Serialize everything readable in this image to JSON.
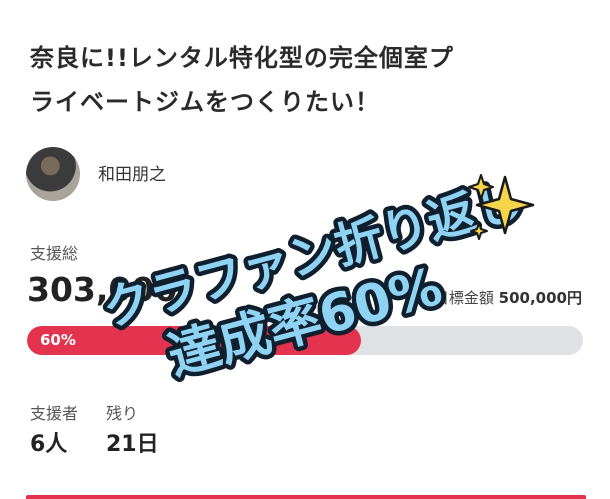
{
  "project": {
    "title_line1": "奈良に!!レンタル特化型の完全個室プ",
    "title_line2": "ライベートジムをつくりたい！",
    "owner_name": "和田朋之"
  },
  "funding": {
    "support_label": "支援総",
    "current_amount": "303,000",
    "goal_label": "目標金額",
    "goal_amount": "500,000円",
    "progress_percent": 60,
    "progress_label": "60%",
    "progress_color": "#e4334f"
  },
  "stats": {
    "supporters_label": "支援者",
    "supporters_value": "6人",
    "remaining_label": "残り",
    "remaining_value": "21日"
  },
  "overlay": {
    "line1": "クラファン折り返し",
    "line2": "達成率60%",
    "sparkle_icon": "sparkles-icon",
    "text_color": "#8fd3f4"
  }
}
